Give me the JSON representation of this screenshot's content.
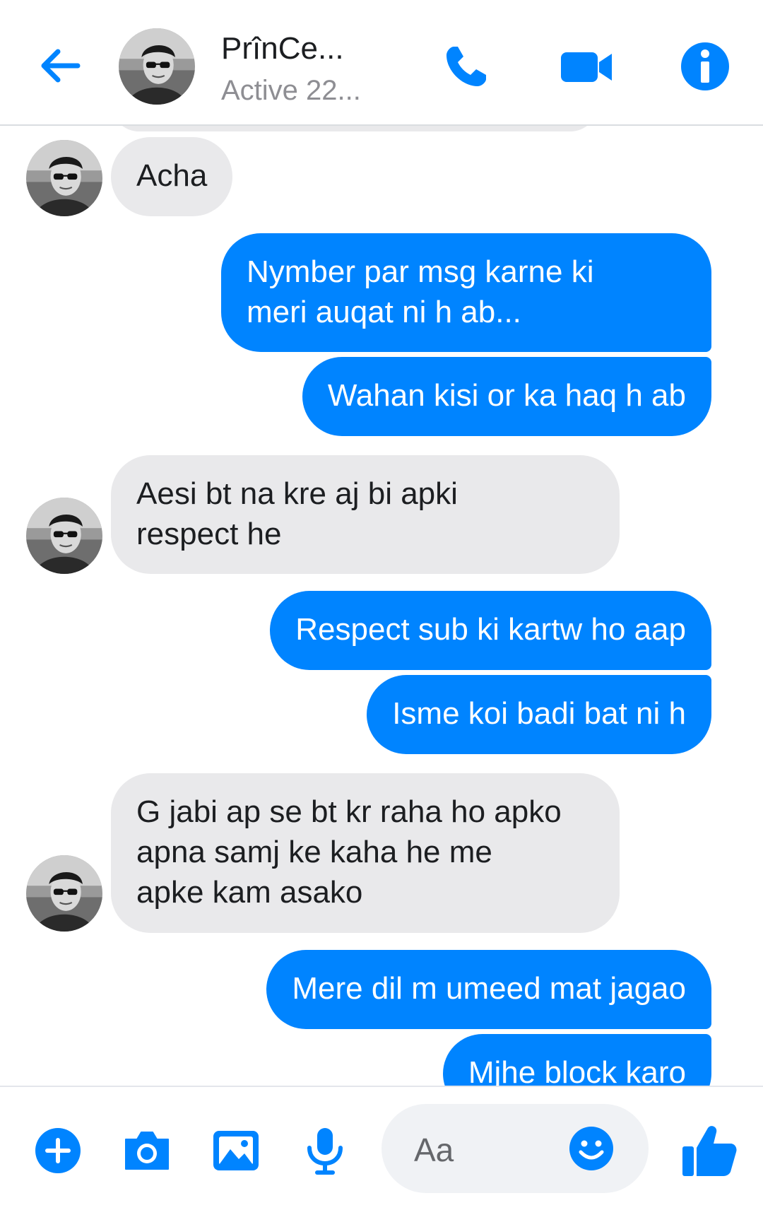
{
  "header": {
    "contact_name": "PrînCe...",
    "status": "Active 22...",
    "icons": {
      "back": "back-arrow-icon",
      "call": "phone-icon",
      "video": "video-camera-icon",
      "info": "info-icon"
    }
  },
  "messages": [
    {
      "direction": "incoming",
      "text": "Acha",
      "avatar": true
    },
    {
      "direction": "outgoing",
      "text": "Nymber par msg karne ki\nmeri auqat ni h ab..."
    },
    {
      "direction": "outgoing",
      "text": "Wahan kisi or ka haq h ab"
    },
    {
      "direction": "incoming",
      "text": "Aesi bt na kre aj bi apki\nrespect he",
      "avatar": true
    },
    {
      "direction": "outgoing",
      "text": "Respect sub ki kartw ho aap"
    },
    {
      "direction": "outgoing",
      "text": "Isme koi badi bat ni h"
    },
    {
      "direction": "incoming",
      "text": "G jabi ap se bt kr raha ho apko\napna samj ke kaha he me\napke kam asako",
      "avatar": true
    },
    {
      "direction": "outgoing",
      "text": "Mere dil m umeed mat jagao"
    },
    {
      "direction": "outgoing",
      "text": "Mjhe block karo"
    }
  ],
  "composer": {
    "placeholder": "Aa",
    "icons": {
      "more": "plus-circle-icon",
      "camera": "camera-icon",
      "gallery": "image-icon",
      "voice": "microphone-icon",
      "emoji": "smiley-icon",
      "like": "thumbs-up-icon"
    }
  },
  "colors": {
    "accent": "#0084ff",
    "incoming_bubble": "#e9e9eb",
    "outgoing_text": "#ffffff",
    "status_text": "#8e8e93"
  }
}
